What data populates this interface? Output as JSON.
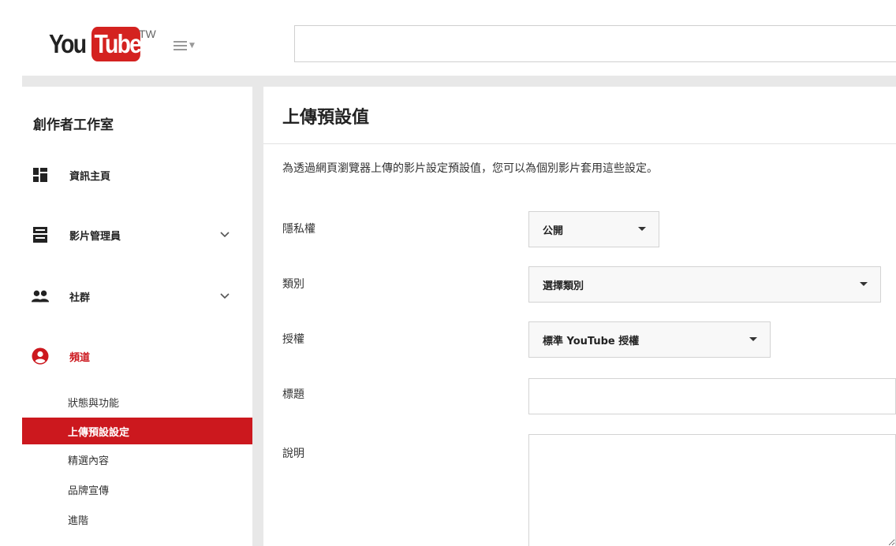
{
  "header": {
    "logo_you": "You",
    "logo_tube": "Tube",
    "logo_country": "TW",
    "guide_icon": "hamburger-menu-icon",
    "search": {
      "value": "",
      "placeholder": ""
    }
  },
  "sidebar": {
    "studio_title": "創作者工作室",
    "items": [
      {
        "label": "資訊主頁",
        "icon": "dashboard-icon",
        "has_chevron": false
      },
      {
        "label": "影片管理員",
        "icon": "video-manager-icon",
        "has_chevron": true
      },
      {
        "label": "社群",
        "icon": "community-icon",
        "has_chevron": true
      },
      {
        "label": "頻道",
        "icon": "channel-account-icon",
        "has_chevron": false,
        "active": true
      }
    ],
    "channel_subitems": [
      {
        "label": "狀態與功能"
      },
      {
        "label": "上傳預設設定",
        "selected": true
      },
      {
        "label": "精選內容"
      },
      {
        "label": "品牌宣傳"
      },
      {
        "label": "進階"
      }
    ]
  },
  "main": {
    "title": "上傳預設值",
    "intro": "為透過網頁瀏覽器上傳的影片設定預設值，您可以為個別影片套用這些設定。",
    "fields": {
      "privacy": {
        "label": "隱私權",
        "value": "公開"
      },
      "category": {
        "label": "類別",
        "value": "選擇類別"
      },
      "license": {
        "label": "授權",
        "value": "標準 YouTube 授權"
      },
      "title": {
        "label": "標題",
        "value": ""
      },
      "description": {
        "label": "說明",
        "value": ""
      }
    }
  },
  "colors": {
    "brand_red": "#cc181e",
    "logo_red": "#d42220",
    "separator_gray": "#e8e8e8"
  }
}
